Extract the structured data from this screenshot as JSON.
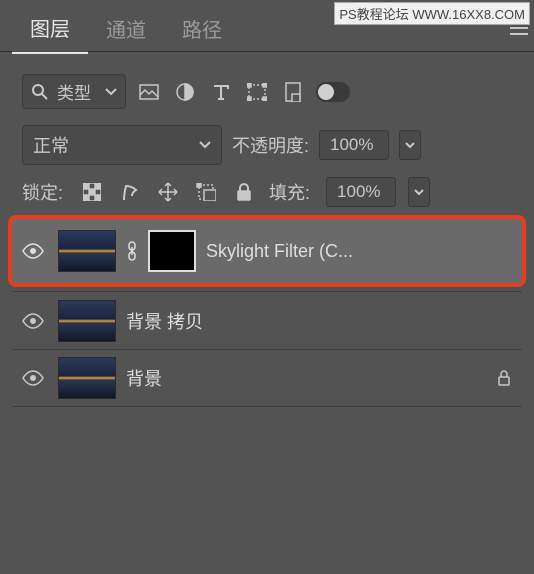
{
  "watermark": "PS教程论坛 WWW.16XX8.COM",
  "tabs": {
    "layers": "图层",
    "channels": "通道",
    "paths": "路径"
  },
  "filter": {
    "type_label": "类型"
  },
  "blend": {
    "mode": "正常",
    "opacity_label": "不透明度:",
    "opacity_value": "100%",
    "fill_label": "填充:",
    "fill_value": "100%"
  },
  "lock": {
    "label": "锁定:"
  },
  "layers": [
    {
      "name": "Skylight Filter (C...",
      "has_mask": true,
      "linked": true,
      "locked": false
    },
    {
      "name": "背景 拷贝",
      "has_mask": false,
      "linked": false,
      "locked": false
    },
    {
      "name": "背景",
      "has_mask": false,
      "linked": false,
      "locked": true
    }
  ]
}
